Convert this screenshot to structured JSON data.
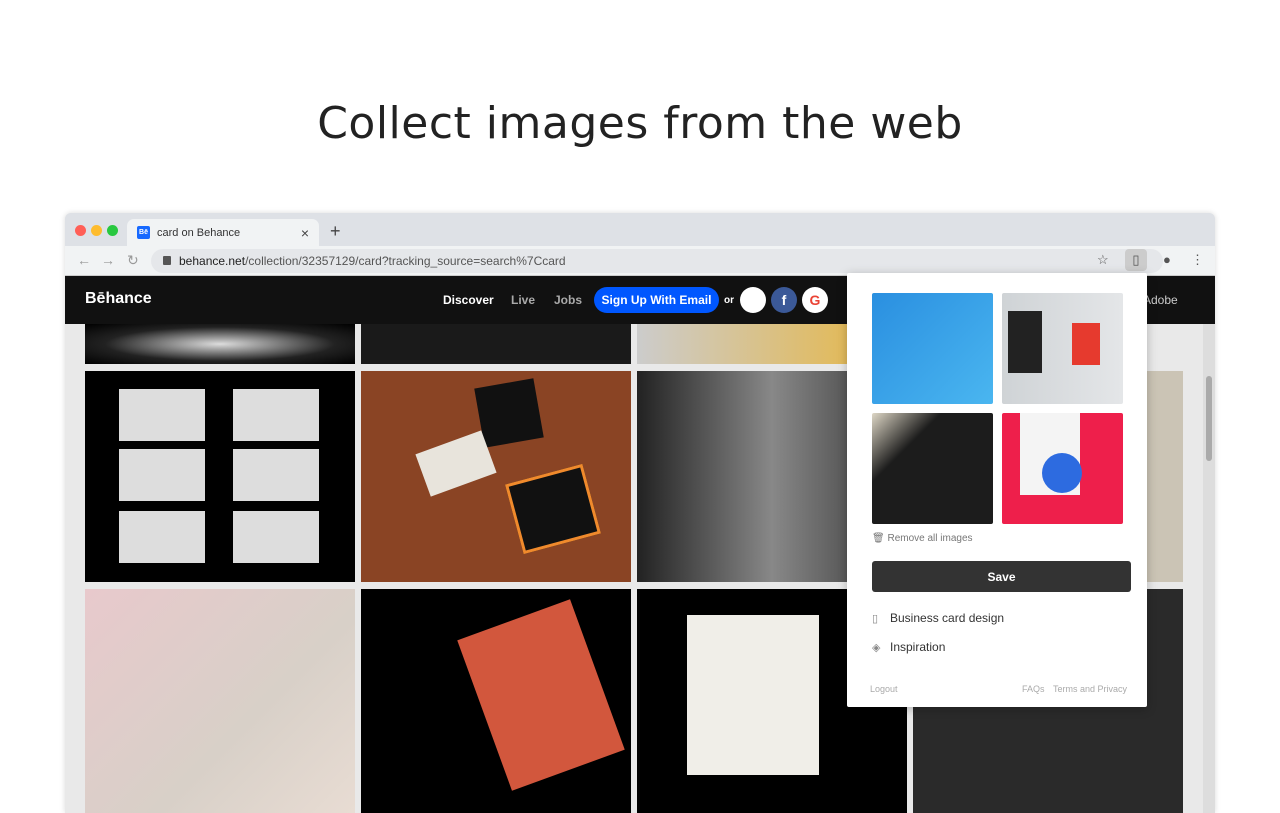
{
  "headline": "Collect images from the web",
  "browser": {
    "tab_title": "card on Behance",
    "favicon": "Bē",
    "url_host": "behance.net",
    "url_path": "/collection/32357129/card?tracking_source=search%7Ccard",
    "new_tab": "+",
    "close": "×"
  },
  "behance": {
    "logo": "Bēhance",
    "nav": [
      "Discover",
      "Live",
      "Jobs"
    ],
    "signup": "Sign Up With Email",
    "or": "or",
    "adobe": "Adobe",
    "accent": "#0057ff"
  },
  "popup": {
    "remove_all": "Remove all images",
    "save": "Save",
    "collections": [
      {
        "icon": "board-icon",
        "label": "Business card design"
      },
      {
        "icon": "stack-icon",
        "label": "Inspiration"
      }
    ],
    "logout": "Logout",
    "faqs": "FAQs",
    "terms": "Terms and Privacy",
    "images": [
      "blue patterned cards",
      "portrait poster mockup",
      "black business card",
      "basketball poster"
    ]
  }
}
